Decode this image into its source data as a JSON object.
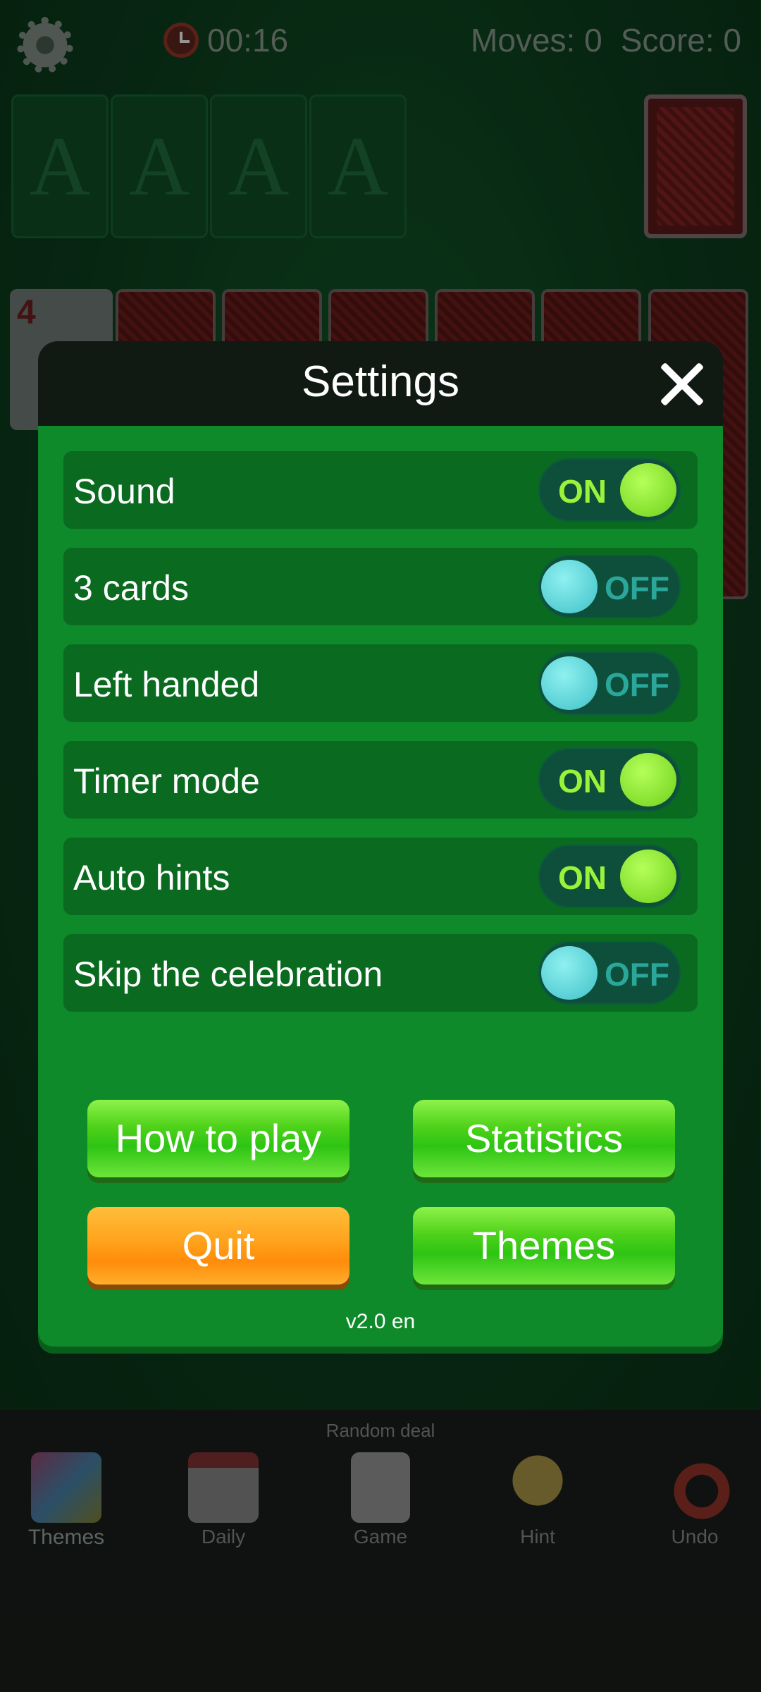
{
  "topbar": {
    "timer": "00:16",
    "moves": "Moves: 0",
    "score": "Score: 0"
  },
  "foundations": [
    "A",
    "A",
    "A",
    "A"
  ],
  "tableau_first_card_rank": "4",
  "settings": {
    "title": "Settings",
    "rows": [
      {
        "label": "Sound",
        "state": "ON"
      },
      {
        "label": "3 cards",
        "state": "OFF"
      },
      {
        "label": "Left handed",
        "state": "OFF"
      },
      {
        "label": "Timer mode",
        "state": "ON"
      },
      {
        "label": "Auto hints",
        "state": "ON"
      },
      {
        "label": "Skip the celebration",
        "state": "OFF"
      }
    ],
    "buttons": {
      "how_to_play": "How to play",
      "statistics": "Statistics",
      "quit": "Quit",
      "themes": "Themes"
    },
    "version": "v2.0 en"
  },
  "bottom": {
    "random_deal": "Random deal",
    "nav": [
      {
        "label": "Themes",
        "icon": "tshirt-icon"
      },
      {
        "label": "Daily",
        "icon": "calendar-icon"
      },
      {
        "label": "Game",
        "icon": "cards-icon"
      },
      {
        "label": "Hint",
        "icon": "lightbulb-icon"
      },
      {
        "label": "Undo",
        "icon": "undo-arrow-icon"
      }
    ]
  },
  "colors": {
    "dialog_green": "#0f8a2a",
    "row_green": "#0a6a1f",
    "toggle_on": "#9bf23a",
    "toggle_off": "#3fc1c8",
    "quit_orange": "#ff9a14"
  }
}
